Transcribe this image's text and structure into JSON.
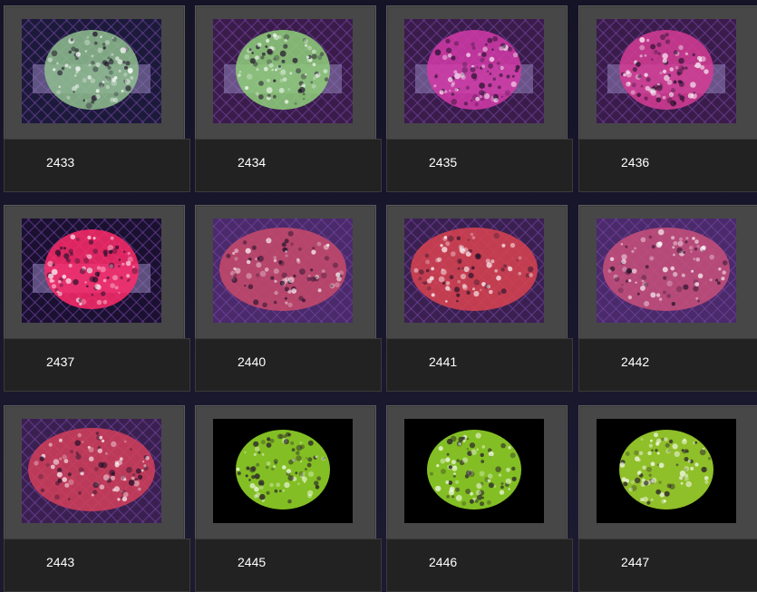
{
  "gallery": {
    "items": [
      {
        "label": "2433",
        "photo": "green-button-polyp-coral",
        "color": "#8fbf8f",
        "bg": "#1c1a3a"
      },
      {
        "label": "2434",
        "photo": "green-pulsing-coral",
        "color": "#8fd07a",
        "bg": "#3a1c4a"
      },
      {
        "label": "2435",
        "photo": "magenta-polyp-coral",
        "color": "#d43aa8",
        "bg": "#3a1c4a"
      },
      {
        "label": "2436",
        "photo": "pink-frilly-coral",
        "color": "#d63c94",
        "bg": "#3a1c4a"
      },
      {
        "label": "2437",
        "photo": "hot-pink-polyp-coral",
        "color": "#ff2a6a",
        "bg": "#1a1030"
      },
      {
        "label": "2440",
        "photo": "red-encrusting-coral",
        "color": "#c84a6a",
        "bg": "#4a2a6a"
      },
      {
        "label": "2441",
        "photo": "red-plate-coral",
        "color": "#d9434f",
        "bg": "#3a2050"
      },
      {
        "label": "2442",
        "photo": "pink-mound-coral",
        "color": "#c8507a",
        "bg": "#4a2a6a"
      },
      {
        "label": "2443",
        "photo": "red-blue-encrusting-coral",
        "color": "#d4405a",
        "bg": "#3a2050"
      },
      {
        "label": "2445",
        "photo": "neon-green-polyp-coral",
        "color": "#9ae02a",
        "bg": "#000000"
      },
      {
        "label": "2446",
        "photo": "neon-green-polyp-coral",
        "color": "#9ae02a",
        "bg": "#000000"
      },
      {
        "label": "2447",
        "photo": "neon-green-polyp-coral",
        "color": "#a8e030",
        "bg": "#000000"
      }
    ]
  }
}
